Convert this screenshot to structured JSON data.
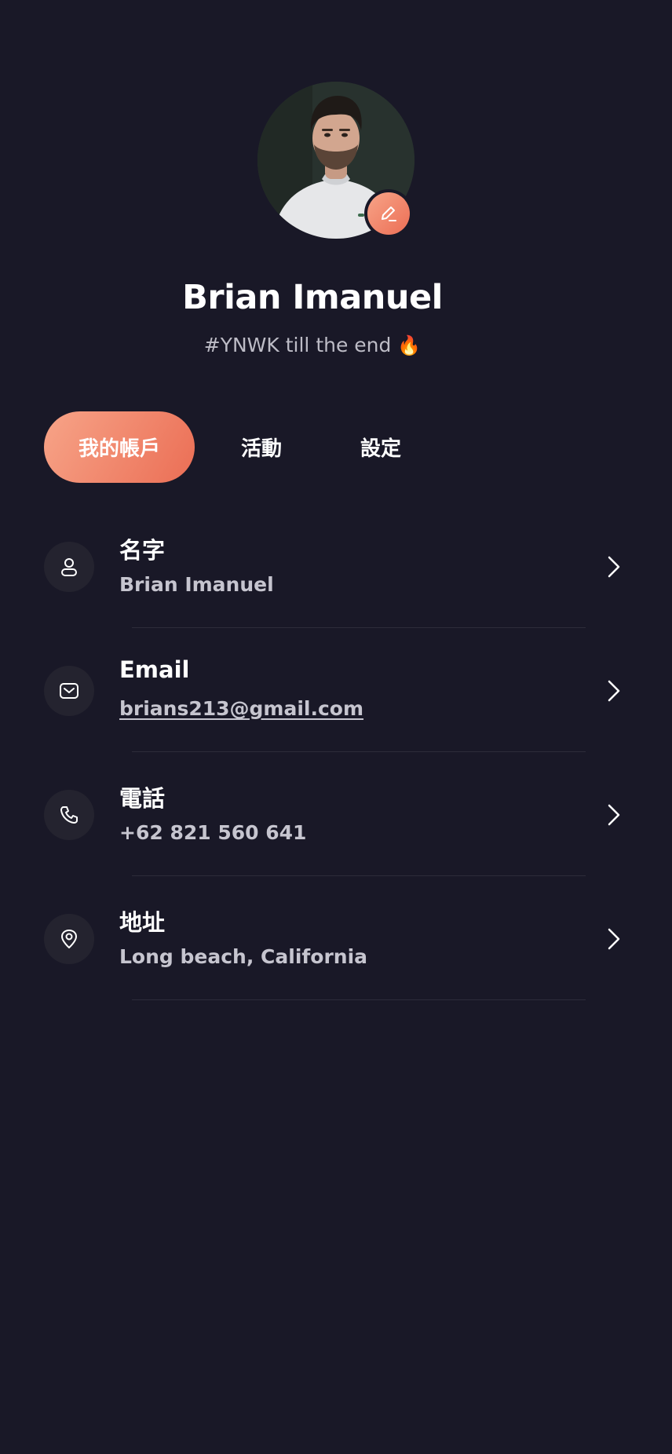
{
  "profile": {
    "name": "Brian Imanuel",
    "bio": "#YNWK till the end",
    "bio_emoji": "🔥"
  },
  "tabs": [
    {
      "label": "我的帳戶",
      "active": true
    },
    {
      "label": "活動",
      "active": false
    },
    {
      "label": "設定",
      "active": false
    }
  ],
  "details": [
    {
      "label": "名字",
      "value": "Brian Imanuel",
      "icon": "user-icon"
    },
    {
      "label": "Email",
      "value": "brians213@gmail.com",
      "icon": "mail-icon"
    },
    {
      "label": "電話",
      "value": "+62 821 560 641",
      "icon": "phone-icon"
    },
    {
      "label": "地址",
      "value": "Long beach, California",
      "icon": "location-pin-icon"
    }
  ],
  "colors": {
    "background": "#191827",
    "accent_start": "#f7a488",
    "accent_end": "#eb6e55",
    "icon_circle": "#24232f",
    "secondary_text": "#c6c5cf"
  }
}
